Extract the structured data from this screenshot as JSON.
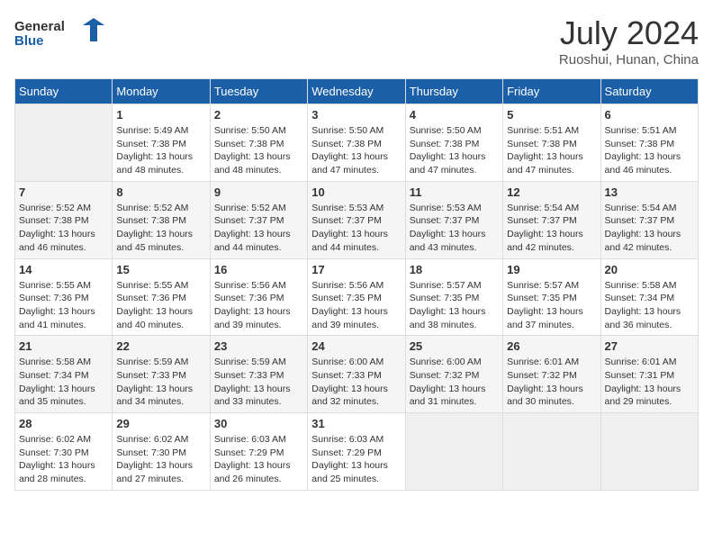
{
  "header": {
    "logo_general": "General",
    "logo_blue": "Blue",
    "month_title": "July 2024",
    "subtitle": "Ruoshui, Hunan, China"
  },
  "weekdays": [
    "Sunday",
    "Monday",
    "Tuesday",
    "Wednesday",
    "Thursday",
    "Friday",
    "Saturday"
  ],
  "weeks": [
    [
      {
        "day": "",
        "sunrise": "",
        "sunset": "",
        "daylight": ""
      },
      {
        "day": "1",
        "sunrise": "Sunrise: 5:49 AM",
        "sunset": "Sunset: 7:38 PM",
        "daylight": "Daylight: 13 hours and 48 minutes."
      },
      {
        "day": "2",
        "sunrise": "Sunrise: 5:50 AM",
        "sunset": "Sunset: 7:38 PM",
        "daylight": "Daylight: 13 hours and 48 minutes."
      },
      {
        "day": "3",
        "sunrise": "Sunrise: 5:50 AM",
        "sunset": "Sunset: 7:38 PM",
        "daylight": "Daylight: 13 hours and 47 minutes."
      },
      {
        "day": "4",
        "sunrise": "Sunrise: 5:50 AM",
        "sunset": "Sunset: 7:38 PM",
        "daylight": "Daylight: 13 hours and 47 minutes."
      },
      {
        "day": "5",
        "sunrise": "Sunrise: 5:51 AM",
        "sunset": "Sunset: 7:38 PM",
        "daylight": "Daylight: 13 hours and 47 minutes."
      },
      {
        "day": "6",
        "sunrise": "Sunrise: 5:51 AM",
        "sunset": "Sunset: 7:38 PM",
        "daylight": "Daylight: 13 hours and 46 minutes."
      }
    ],
    [
      {
        "day": "7",
        "sunrise": "Sunrise: 5:52 AM",
        "sunset": "Sunset: 7:38 PM",
        "daylight": "Daylight: 13 hours and 46 minutes."
      },
      {
        "day": "8",
        "sunrise": "Sunrise: 5:52 AM",
        "sunset": "Sunset: 7:38 PM",
        "daylight": "Daylight: 13 hours and 45 minutes."
      },
      {
        "day": "9",
        "sunrise": "Sunrise: 5:52 AM",
        "sunset": "Sunset: 7:37 PM",
        "daylight": "Daylight: 13 hours and 44 minutes."
      },
      {
        "day": "10",
        "sunrise": "Sunrise: 5:53 AM",
        "sunset": "Sunset: 7:37 PM",
        "daylight": "Daylight: 13 hours and 44 minutes."
      },
      {
        "day": "11",
        "sunrise": "Sunrise: 5:53 AM",
        "sunset": "Sunset: 7:37 PM",
        "daylight": "Daylight: 13 hours and 43 minutes."
      },
      {
        "day": "12",
        "sunrise": "Sunrise: 5:54 AM",
        "sunset": "Sunset: 7:37 PM",
        "daylight": "Daylight: 13 hours and 42 minutes."
      },
      {
        "day": "13",
        "sunrise": "Sunrise: 5:54 AM",
        "sunset": "Sunset: 7:37 PM",
        "daylight": "Daylight: 13 hours and 42 minutes."
      }
    ],
    [
      {
        "day": "14",
        "sunrise": "Sunrise: 5:55 AM",
        "sunset": "Sunset: 7:36 PM",
        "daylight": "Daylight: 13 hours and 41 minutes."
      },
      {
        "day": "15",
        "sunrise": "Sunrise: 5:55 AM",
        "sunset": "Sunset: 7:36 PM",
        "daylight": "Daylight: 13 hours and 40 minutes."
      },
      {
        "day": "16",
        "sunrise": "Sunrise: 5:56 AM",
        "sunset": "Sunset: 7:36 PM",
        "daylight": "Daylight: 13 hours and 39 minutes."
      },
      {
        "day": "17",
        "sunrise": "Sunrise: 5:56 AM",
        "sunset": "Sunset: 7:35 PM",
        "daylight": "Daylight: 13 hours and 39 minutes."
      },
      {
        "day": "18",
        "sunrise": "Sunrise: 5:57 AM",
        "sunset": "Sunset: 7:35 PM",
        "daylight": "Daylight: 13 hours and 38 minutes."
      },
      {
        "day": "19",
        "sunrise": "Sunrise: 5:57 AM",
        "sunset": "Sunset: 7:35 PM",
        "daylight": "Daylight: 13 hours and 37 minutes."
      },
      {
        "day": "20",
        "sunrise": "Sunrise: 5:58 AM",
        "sunset": "Sunset: 7:34 PM",
        "daylight": "Daylight: 13 hours and 36 minutes."
      }
    ],
    [
      {
        "day": "21",
        "sunrise": "Sunrise: 5:58 AM",
        "sunset": "Sunset: 7:34 PM",
        "daylight": "Daylight: 13 hours and 35 minutes."
      },
      {
        "day": "22",
        "sunrise": "Sunrise: 5:59 AM",
        "sunset": "Sunset: 7:33 PM",
        "daylight": "Daylight: 13 hours and 34 minutes."
      },
      {
        "day": "23",
        "sunrise": "Sunrise: 5:59 AM",
        "sunset": "Sunset: 7:33 PM",
        "daylight": "Daylight: 13 hours and 33 minutes."
      },
      {
        "day": "24",
        "sunrise": "Sunrise: 6:00 AM",
        "sunset": "Sunset: 7:33 PM",
        "daylight": "Daylight: 13 hours and 32 minutes."
      },
      {
        "day": "25",
        "sunrise": "Sunrise: 6:00 AM",
        "sunset": "Sunset: 7:32 PM",
        "daylight": "Daylight: 13 hours and 31 minutes."
      },
      {
        "day": "26",
        "sunrise": "Sunrise: 6:01 AM",
        "sunset": "Sunset: 7:32 PM",
        "daylight": "Daylight: 13 hours and 30 minutes."
      },
      {
        "day": "27",
        "sunrise": "Sunrise: 6:01 AM",
        "sunset": "Sunset: 7:31 PM",
        "daylight": "Daylight: 13 hours and 29 minutes."
      }
    ],
    [
      {
        "day": "28",
        "sunrise": "Sunrise: 6:02 AM",
        "sunset": "Sunset: 7:30 PM",
        "daylight": "Daylight: 13 hours and 28 minutes."
      },
      {
        "day": "29",
        "sunrise": "Sunrise: 6:02 AM",
        "sunset": "Sunset: 7:30 PM",
        "daylight": "Daylight: 13 hours and 27 minutes."
      },
      {
        "day": "30",
        "sunrise": "Sunrise: 6:03 AM",
        "sunset": "Sunset: 7:29 PM",
        "daylight": "Daylight: 13 hours and 26 minutes."
      },
      {
        "day": "31",
        "sunrise": "Sunrise: 6:03 AM",
        "sunset": "Sunset: 7:29 PM",
        "daylight": "Daylight: 13 hours and 25 minutes."
      },
      {
        "day": "",
        "sunrise": "",
        "sunset": "",
        "daylight": ""
      },
      {
        "day": "",
        "sunrise": "",
        "sunset": "",
        "daylight": ""
      },
      {
        "day": "",
        "sunrise": "",
        "sunset": "",
        "daylight": ""
      }
    ]
  ]
}
